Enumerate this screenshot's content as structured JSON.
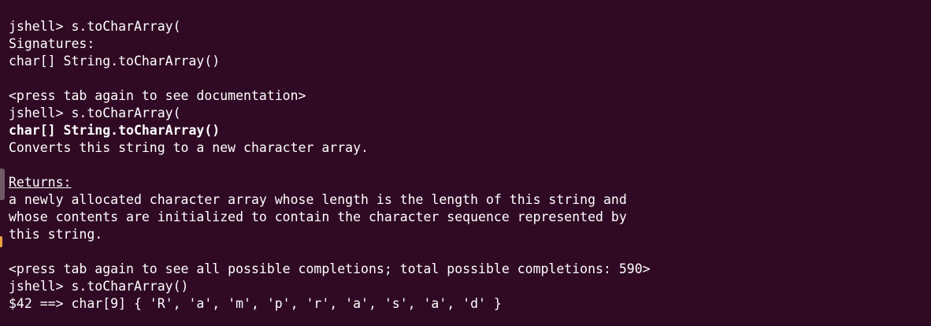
{
  "terminal": {
    "lines": [
      "jshell> s.toCharArray(",
      "Signatures:",
      "char[] String.toCharArray()",
      "",
      "<press tab again to see documentation>",
      "jshell> s.toCharArray(",
      "char[] String.toCharArray()",
      "Converts this string to a new character array.",
      "",
      "Returns:",
      "a newly allocated character array whose length is the length of this string and",
      "whose contents are initialized to contain the character sequence represented by",
      "this string.",
      "",
      "<press tab again to see all possible completions; total possible completions: 590>",
      "jshell> s.toCharArray()",
      "$42 ==> char[9] { 'R', 'a', 'm', 'p', 'r', 'a', 's', 'a', 'd' }"
    ]
  },
  "colors": {
    "background": "#300a24",
    "foreground": "#ffffff"
  }
}
